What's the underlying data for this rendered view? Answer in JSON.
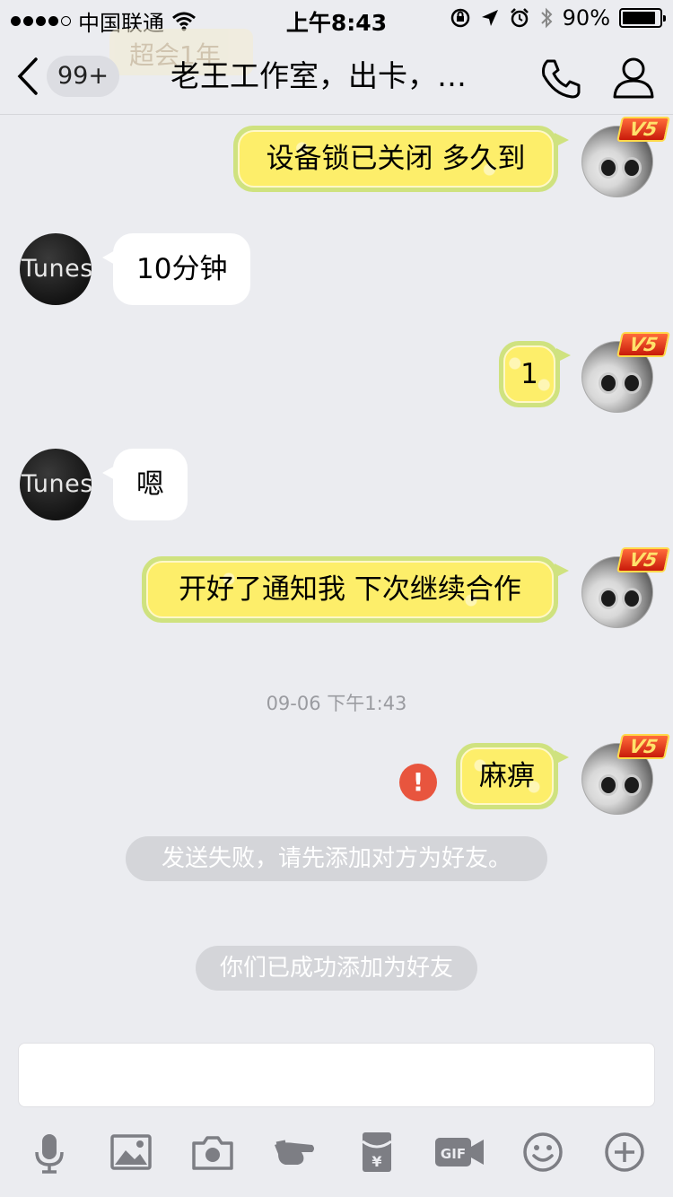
{
  "status_bar": {
    "carrier": "中国联通",
    "time": "上午8:43",
    "battery": "90%",
    "battery_level": 0.9,
    "signal_dots_filled": 4
  },
  "nav": {
    "ghost_text": "超会1年",
    "badge": "99+",
    "title": "老王工作室，出卡，…",
    "icons": [
      "back-chevron-icon",
      "phone-icon",
      "person-icon"
    ]
  },
  "avatar_other_text": "Tunes",
  "vip_badge": "V5",
  "messages": [
    {
      "from": "me",
      "text": "设备锁已关闭 多久到"
    },
    {
      "from": "other",
      "text": "10分钟"
    },
    {
      "from": "me",
      "text": "1"
    },
    {
      "from": "other",
      "text": "嗯"
    },
    {
      "from": "me",
      "text": "开好了通知我 下次继续合作"
    },
    {
      "from": "me",
      "text": "麻痹",
      "failed": true
    }
  ],
  "timestamp": "09-06 下午1:43",
  "error_mark": "!",
  "system": {
    "send_failed": "发送失败，请先添加对方为好友。",
    "friend_added": "你们已成功添加为好友"
  },
  "toolbar_icons": [
    "microphone-icon",
    "image-icon",
    "camera-icon",
    "poke-hand-icon",
    "red-packet-icon",
    "gif-icon",
    "emoji-icon",
    "plus-icon"
  ],
  "toolbar_gif_label": "GIF",
  "colors": {
    "bg": "#ebecf0",
    "bubble_yellow": "#fdee6a",
    "bubble_rim": "#cfe27f",
    "error": "#e8553e",
    "icon": "#7d7e84"
  }
}
